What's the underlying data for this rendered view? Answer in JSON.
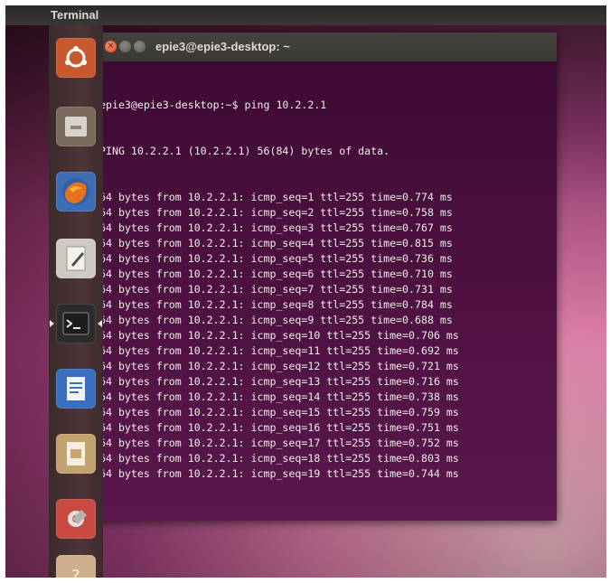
{
  "top_bar": {
    "app_title": "Terminal"
  },
  "launcher": {
    "items": [
      {
        "name": "dash-icon",
        "color": "#c8592f"
      },
      {
        "name": "files-icon",
        "color": "#7a6a5c"
      },
      {
        "name": "firefox-icon",
        "color": "#e66b1c"
      },
      {
        "name": "text-editor-icon",
        "color": "#c6c0b7"
      },
      {
        "name": "terminal-icon",
        "color": "#2b2b2b"
      },
      {
        "name": "writer-icon",
        "color": "#3a6fbf"
      },
      {
        "name": "document-viewer-icon",
        "color": "#c2a36f"
      },
      {
        "name": "system-settings-icon",
        "color": "#c94a43"
      },
      {
        "name": "help-icon",
        "color": "#cfae8c"
      }
    ]
  },
  "terminal": {
    "title": "epie3@epie3-desktop: ~",
    "prompt": "epie3@epie3-desktop:~$ ping 10.2.2.1",
    "header": "PING 10.2.2.1 (10.2.2.1) 56(84) bytes of data.",
    "replies": [
      "64 bytes from 10.2.2.1: icmp_seq=1 ttl=255 time=0.774 ms",
      "64 bytes from 10.2.2.1: icmp_seq=2 ttl=255 time=0.758 ms",
      "64 bytes from 10.2.2.1: icmp_seq=3 ttl=255 time=0.767 ms",
      "64 bytes from 10.2.2.1: icmp_seq=4 ttl=255 time=0.815 ms",
      "64 bytes from 10.2.2.1: icmp_seq=5 ttl=255 time=0.736 ms",
      "64 bytes from 10.2.2.1: icmp_seq=6 ttl=255 time=0.710 ms",
      "64 bytes from 10.2.2.1: icmp_seq=7 ttl=255 time=0.731 ms",
      "64 bytes from 10.2.2.1: icmp_seq=8 ttl=255 time=0.784 ms",
      "64 bytes from 10.2.2.1: icmp_seq=9 ttl=255 time=0.688 ms",
      "64 bytes from 10.2.2.1: icmp_seq=10 ttl=255 time=0.706 ms",
      "64 bytes from 10.2.2.1: icmp_seq=11 ttl=255 time=0.692 ms",
      "64 bytes from 10.2.2.1: icmp_seq=12 ttl=255 time=0.721 ms",
      "64 bytes from 10.2.2.1: icmp_seq=13 ttl=255 time=0.716 ms",
      "64 bytes from 10.2.2.1: icmp_seq=14 ttl=255 time=0.738 ms",
      "64 bytes from 10.2.2.1: icmp_seq=15 ttl=255 time=0.759 ms",
      "64 bytes from 10.2.2.1: icmp_seq=16 ttl=255 time=0.751 ms",
      "64 bytes from 10.2.2.1: icmp_seq=17 ttl=255 time=0.752 ms",
      "64 bytes from 10.2.2.1: icmp_seq=18 ttl=255 time=0.803 ms",
      "64 bytes from 10.2.2.1: icmp_seq=19 ttl=255 time=0.744 ms"
    ]
  }
}
